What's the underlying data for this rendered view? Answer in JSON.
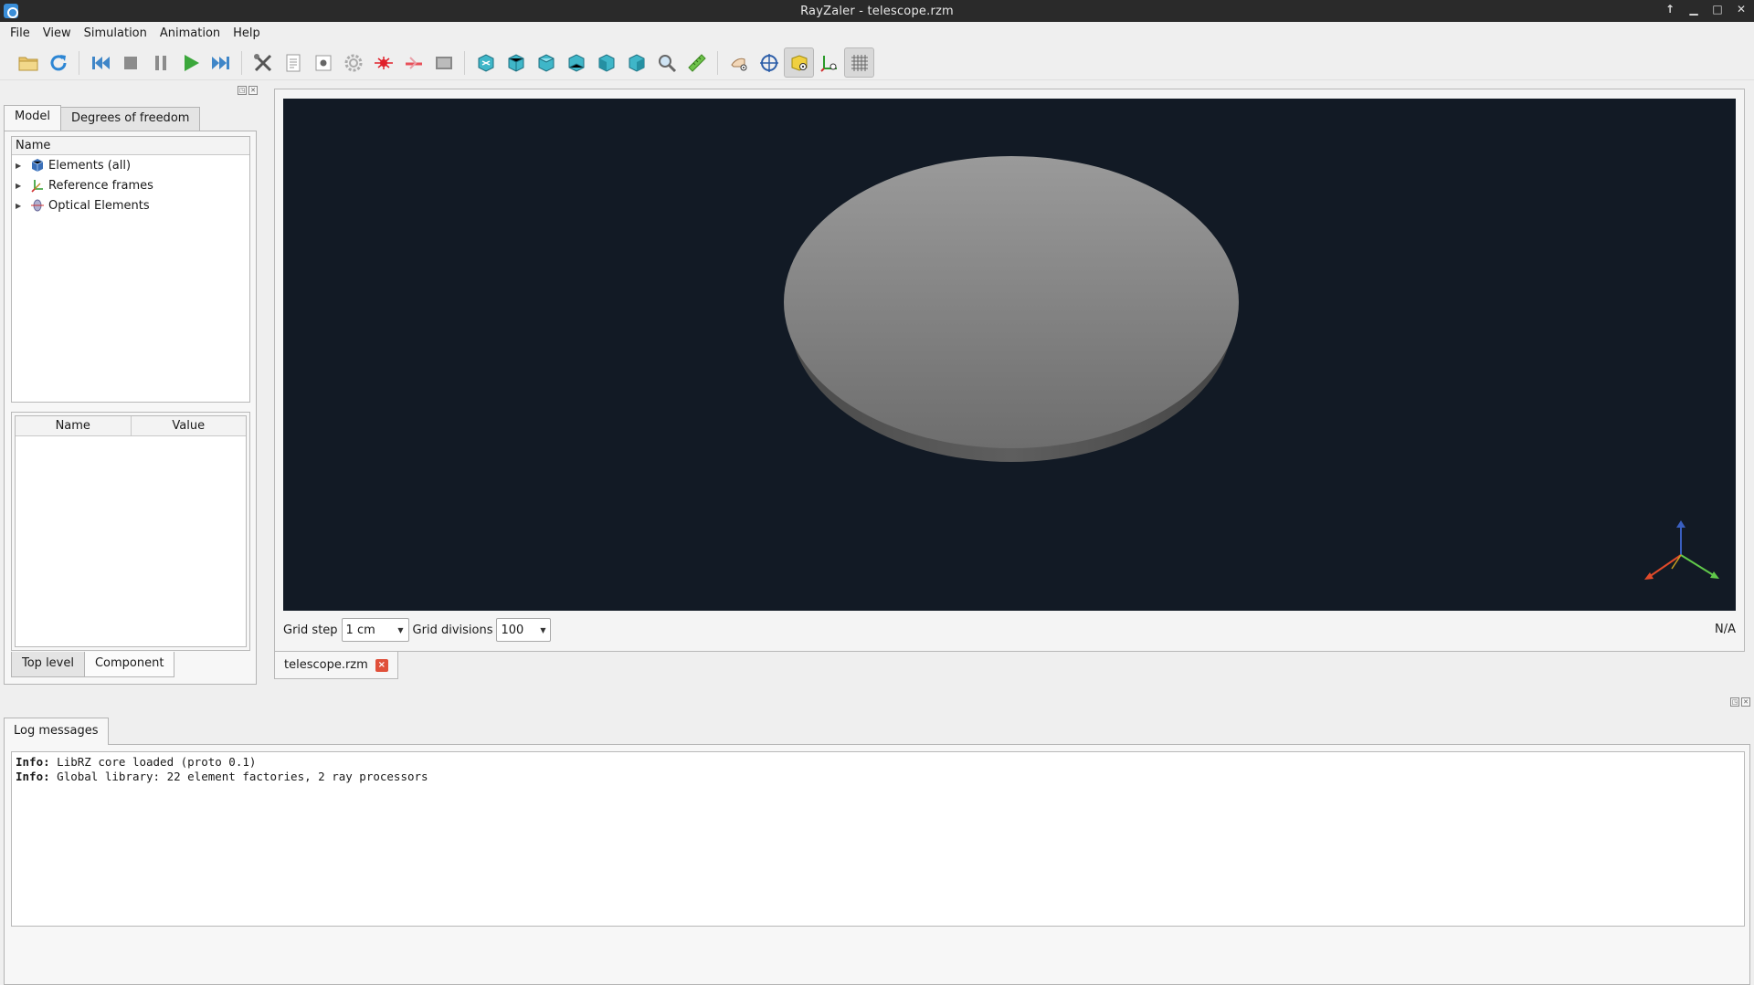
{
  "window": {
    "title": "RayZaler - telescope.rzm",
    "controls": [
      "↑",
      "▁",
      "□",
      "✕"
    ]
  },
  "menubar": [
    {
      "label": "File"
    },
    {
      "label": "View"
    },
    {
      "label": "Simulation"
    },
    {
      "label": "Animation"
    },
    {
      "label": "Help"
    }
  ],
  "toolbar": {
    "icons": [
      "open-folder-icon",
      "reload-icon",
      "rewind-icon",
      "stop-icon",
      "pause-icon",
      "play-icon",
      "fast-forward-icon",
      "tools-icon",
      "document-icon",
      "settings-icon",
      "gear-icon",
      "laser-icon",
      "laser-beam-icon",
      "screen-icon",
      "view-front-icon",
      "view-rear-icon",
      "view-top-icon",
      "view-bottom-icon",
      "view-left-icon",
      "view-right-icon",
      "zoom-icon",
      "ruler-icon",
      "hand-eye-icon",
      "target-icon",
      "box-eye-icon",
      "axes-eye-icon",
      "grid-icon"
    ]
  },
  "left_panel": {
    "tabs": [
      "Model",
      "Degrees of freedom"
    ],
    "active_tab": "Model",
    "tree": {
      "header": "Name",
      "items": [
        {
          "label": "Elements (all)",
          "icon": "cube-icon"
        },
        {
          "label": "Reference frames",
          "icon": "axes-icon"
        },
        {
          "label": "Optical Elements",
          "icon": "lens-icon"
        }
      ]
    },
    "properties": {
      "columns": [
        "Name",
        "Value"
      ]
    },
    "subtabs": [
      "Top level",
      "Component"
    ],
    "active_subtab": "Component"
  },
  "viewport": {
    "background": "#121a25",
    "grid_step_label": "Grid step",
    "grid_step_value": "1 cm",
    "grid_divisions_label": "Grid divisions",
    "grid_divisions_value": "100",
    "status": "N/A"
  },
  "document_tab": {
    "label": "telescope.rzm"
  },
  "log": {
    "tab": "Log messages",
    "lines": [
      {
        "level": "Info:",
        "text": " LibRZ core loaded (proto 0.1)"
      },
      {
        "level": "Info:",
        "text": " Global library: 22 element factories, 2 ray processors"
      }
    ]
  }
}
